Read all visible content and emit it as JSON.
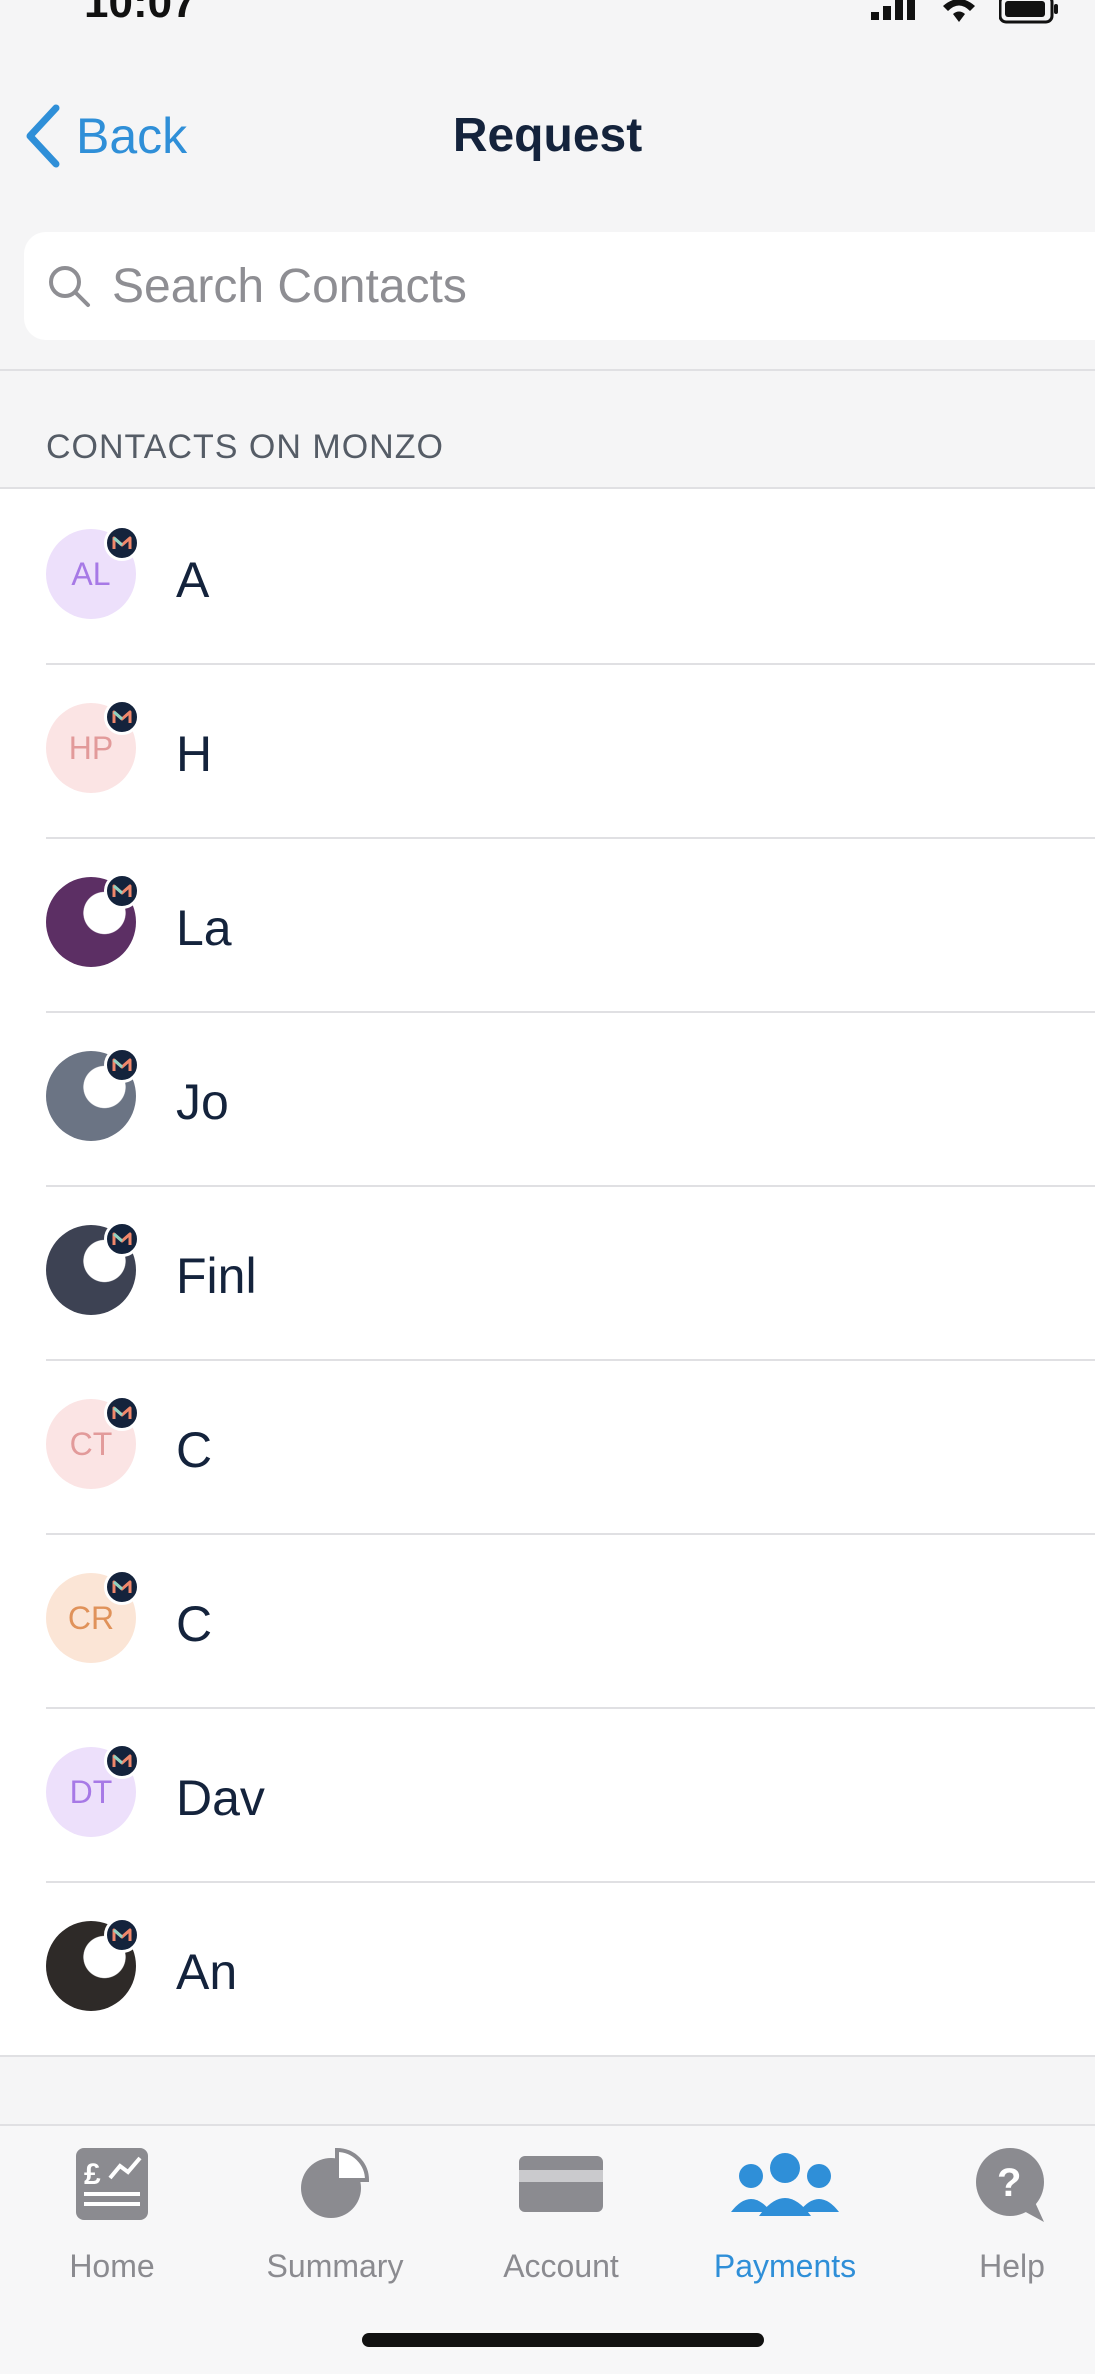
{
  "status_bar": {
    "time": "10:07"
  },
  "nav": {
    "back_label": "Back",
    "title": "Request"
  },
  "search": {
    "placeholder": "Search Contacts"
  },
  "section": {
    "header": "CONTACTS ON MONZO"
  },
  "contacts": [
    {
      "initials": "AL",
      "name": "A",
      "avatar_type": "initials",
      "bg": "#ede0fb",
      "fg": "#a779e6"
    },
    {
      "initials": "HP",
      "name": "H",
      "avatar_type": "initials",
      "bg": "#fbe4e4",
      "fg": "#e29a9a"
    },
    {
      "initials": "",
      "name": "La",
      "avatar_type": "photo",
      "bg": "#5c2f64",
      "fg": "#ffffff"
    },
    {
      "initials": "",
      "name": "Jo",
      "avatar_type": "photo",
      "bg": "#6b7484",
      "fg": "#ffffff"
    },
    {
      "initials": "",
      "name": "Finl",
      "avatar_type": "photo",
      "bg": "#3d4253",
      "fg": "#ffffff"
    },
    {
      "initials": "CT",
      "name": "C",
      "avatar_type": "initials",
      "bg": "#fbe4e4",
      "fg": "#e29a9a"
    },
    {
      "initials": "CR",
      "name": "C",
      "avatar_type": "initials",
      "bg": "#fbe5d6",
      "fg": "#e0925a"
    },
    {
      "initials": "DT",
      "name": "Dav",
      "avatar_type": "initials",
      "bg": "#ede0fb",
      "fg": "#a779e6"
    },
    {
      "initials": "",
      "name": "An",
      "avatar_type": "photo",
      "bg": "#2e2a28",
      "fg": "#ffffff"
    }
  ],
  "tabs": [
    {
      "label": "Home",
      "icon": "home-statement-icon",
      "active": false
    },
    {
      "label": "Summary",
      "icon": "pie-chart-icon",
      "active": false
    },
    {
      "label": "Account",
      "icon": "card-icon",
      "active": false
    },
    {
      "label": "Payments",
      "icon": "people-icon",
      "active": true
    },
    {
      "label": "Help",
      "icon": "help-bubble-icon",
      "active": false
    }
  ],
  "colors": {
    "accent": "#2f8fd8",
    "text": "#14233c",
    "muted": "#8b8b90"
  }
}
